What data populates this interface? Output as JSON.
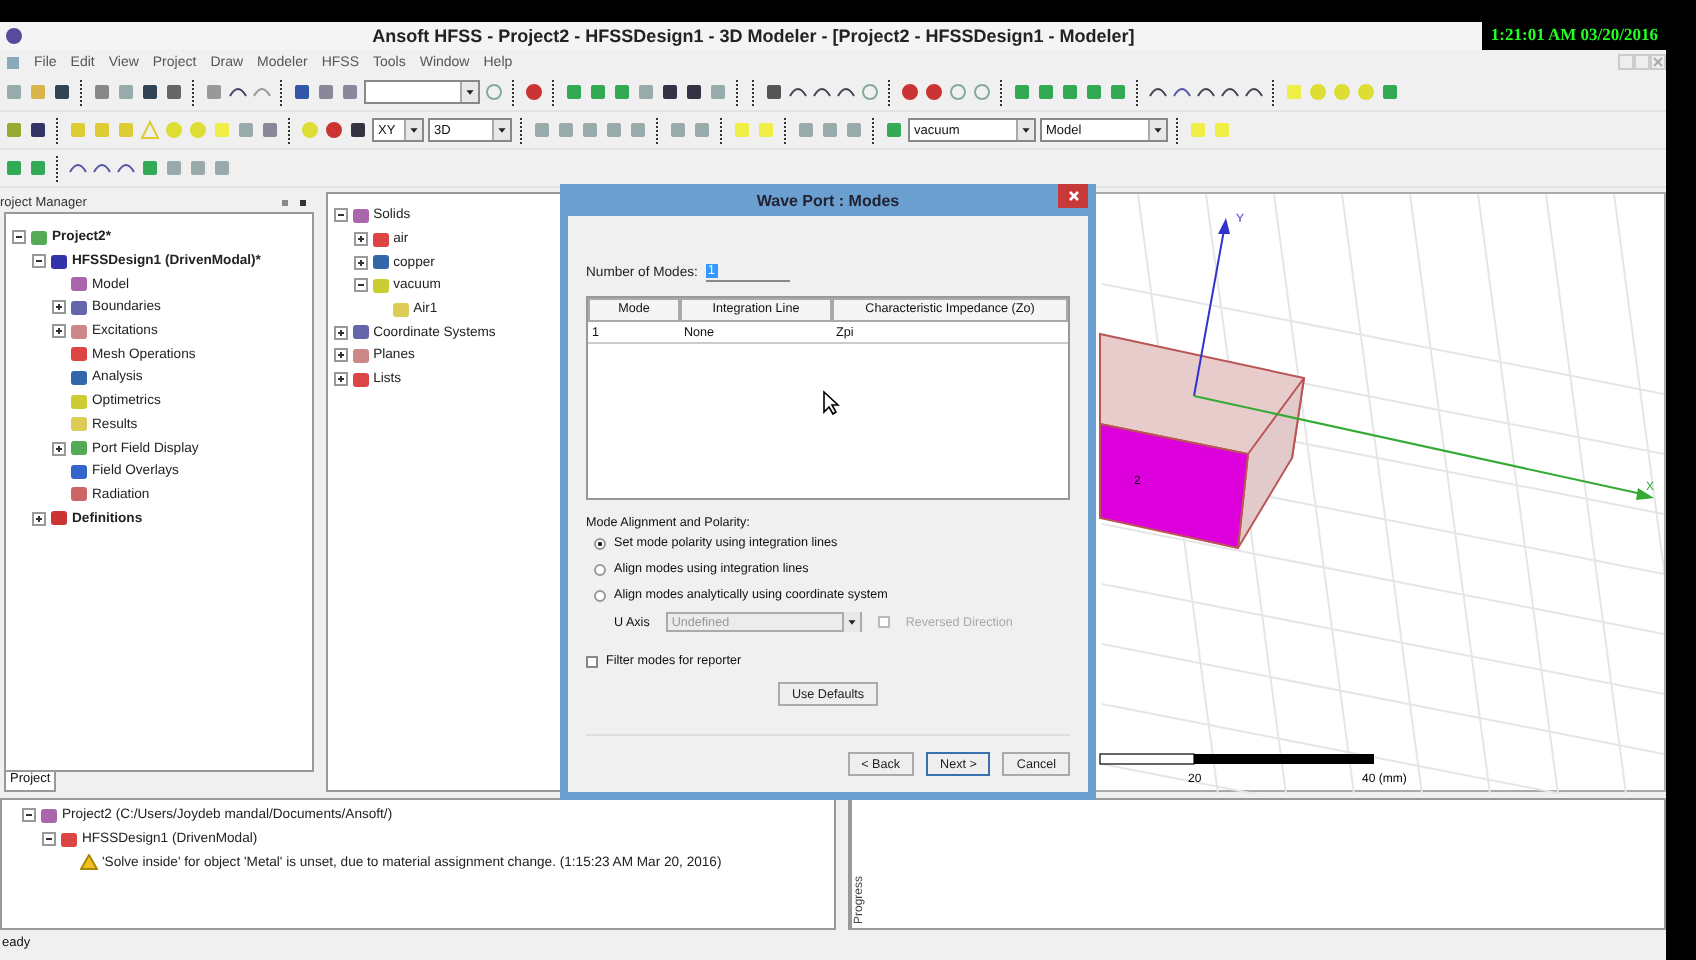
{
  "window": {
    "title": "Ansoft HFSS  - Project2 - HFSSDesign1 - 3D Modeler - [Project2 - HFSSDesign1 - Modeler]",
    "clock": "1:21:01 AM 03/20/2016"
  },
  "menu": [
    "File",
    "Edit",
    "View",
    "Project",
    "Draw",
    "Modeler",
    "HFSS",
    "Tools",
    "Window",
    "Help"
  ],
  "toolbar_dropdowns": [
    "XY",
    "3D",
    "vacuum",
    "Model"
  ],
  "project_manager": {
    "title": "roject Manager",
    "tab": "Project",
    "tree": [
      {
        "label": "Project2*",
        "expanded": true,
        "children": [
          {
            "label": "HFSSDesign1 (DrivenModal)*",
            "expanded": true,
            "children": [
              {
                "label": "Model"
              },
              {
                "label": "Boundaries",
                "expanded": false
              },
              {
                "label": "Excitations",
                "expanded": false
              },
              {
                "label": "Mesh Operations"
              },
              {
                "label": "Analysis"
              },
              {
                "label": "Optimetrics"
              },
              {
                "label": "Results"
              },
              {
                "label": "Port Field Display",
                "expanded": false
              },
              {
                "label": "Field Overlays"
              },
              {
                "label": "Radiation"
              }
            ]
          },
          {
            "label": "Definitions",
            "expanded": false
          }
        ]
      }
    ]
  },
  "model_tree": [
    {
      "label": "Solids",
      "expanded": true,
      "children": [
        {
          "label": "air",
          "expanded": false
        },
        {
          "label": "copper",
          "expanded": false
        },
        {
          "label": "vacuum",
          "expanded": true,
          "children": [
            {
              "label": "Air1"
            }
          ]
        }
      ]
    },
    {
      "label": "Coordinate Systems",
      "expanded": false
    },
    {
      "label": "Planes",
      "expanded": false
    },
    {
      "label": "Lists",
      "expanded": false
    }
  ],
  "viewport": {
    "axis_labels": [
      "Y",
      "X"
    ],
    "face_label": "2",
    "scale_labels": [
      "20",
      "40 (mm)"
    ]
  },
  "dialog": {
    "title": "Wave Port : Modes",
    "number_of_modes_label": "Number of Modes:",
    "number_of_modes": "1",
    "table": {
      "columns": [
        "Mode",
        "Integration Line",
        "Characteristic Impedance (Zo)"
      ],
      "rows": [
        [
          "1",
          "None",
          "Zpi"
        ]
      ]
    },
    "alignment": {
      "label": "Mode Alignment and Polarity:",
      "options": [
        {
          "label": "Set mode polarity using integration lines",
          "selected": true
        },
        {
          "label": "Align modes using integration lines",
          "selected": false
        },
        {
          "label": "Align modes analytically using coordinate system",
          "selected": false
        }
      ]
    },
    "u_axis": {
      "label": "U Axis",
      "value": "Undefined",
      "disabled": true
    },
    "reversed_direction": {
      "label": "Reversed Direction",
      "checked": false,
      "disabled": true
    },
    "filter_modes": {
      "label": "Filter modes for reporter",
      "checked": false
    },
    "use_defaults": "Use Defaults",
    "buttons": [
      "< Back",
      "Next >",
      "Cancel"
    ]
  },
  "messages": [
    {
      "label": "Project2 (C:/Users/Joydeb mandal/Documents/Ansoft/)",
      "expanded": true,
      "children": [
        {
          "label": "HFSSDesign1 (DrivenModal)",
          "expanded": true,
          "children": [
            {
              "label": "'Solve inside' for object 'Metal' is unset, due to material assignment change.  (1:15:23 AM  Mar 20, 2016)",
              "kind": "warning"
            }
          ]
        }
      ]
    }
  ],
  "progress_label": "Progress",
  "status_bar": "eady"
}
